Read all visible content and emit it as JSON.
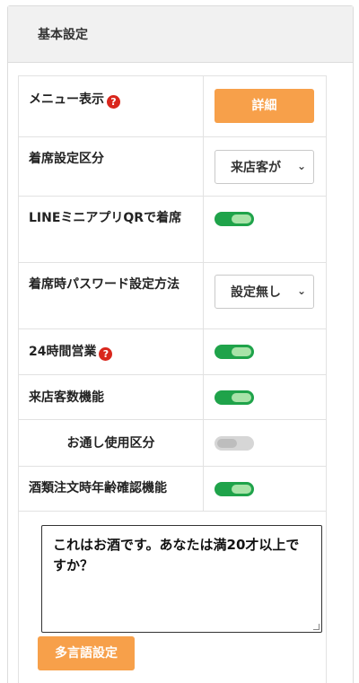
{
  "panel": {
    "title": "基本設定"
  },
  "rows": {
    "menu_display": {
      "label": "メニュー表示",
      "button": "詳細"
    },
    "seat_category": {
      "label": "着席設定区分",
      "select": "来店客が"
    },
    "line_qr": {
      "label": "LINEミニアプリQRで着席",
      "toggle": "on"
    },
    "seat_password": {
      "label": "着席時パスワード設定方法",
      "select": "設定無し"
    },
    "open_24h": {
      "label": "24時間営業",
      "toggle": "on"
    },
    "visitor_count": {
      "label": "来店客数機能",
      "toggle": "on"
    },
    "otoshi": {
      "label": "お通し使用区分",
      "toggle": "off"
    },
    "alcohol_age": {
      "label": "酒類注文時年齢確認機能",
      "toggle": "on"
    }
  },
  "alcohol_message": "これはお酒です。あなたは満20才以上ですか？",
  "multilang_button": "多言語設定",
  "icons": {
    "help": "question-circle-icon",
    "select_arrow": "chevron-down-icon"
  },
  "colors": {
    "accent_orange": "#f7a04a",
    "toggle_on": "#1fa34a",
    "toggle_off": "#d6d6d6",
    "help_red": "#d9261c"
  }
}
